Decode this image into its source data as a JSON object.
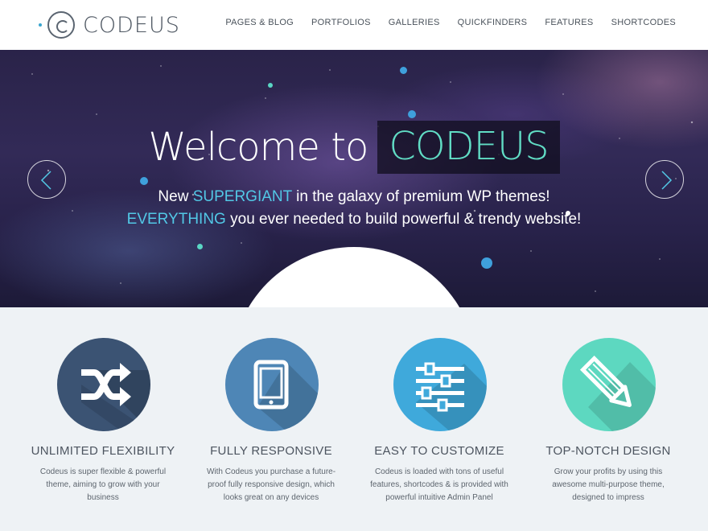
{
  "header": {
    "logo_text": "CODEUS",
    "nav": [
      "PAGES & BLOG",
      "PORTFOLIOS",
      "GALLERIES",
      "QUICKFINDERS",
      "FEATURES",
      "SHORTCODES"
    ]
  },
  "hero": {
    "welcome": "Welcome to",
    "brand": "CODEUS",
    "line1_pre": "New ",
    "line1_highlight": "SUPERGIANT",
    "line1_post": " in the galaxy of premium WP themes!",
    "line2_highlight": "EVERYTHING",
    "line2_post": " you ever needed to build powerful & trendy website!",
    "prev_icon": "chevron-left-icon",
    "next_icon": "chevron-right-icon"
  },
  "features": [
    {
      "title": "UNLIMITED FLEXIBILITY",
      "desc": "Codeus is super flexible & powerful theme, aiming to grow with your business",
      "icon": "shuffle-icon",
      "color": "#3b5373"
    },
    {
      "title": "FULLY RESPONSIVE",
      "desc": "With Codeus you purchase a future-proof fully responsive design, which looks great on any devices",
      "icon": "tablet-icon",
      "color": "#4e86b6"
    },
    {
      "title": "EASY TO CUSTOMIZE",
      "desc": "Codeus is loaded with tons of useful features, shortcodes & is provided with powerful intuitive Admin Panel",
      "icon": "sliders-icon",
      "color": "#3fa9db"
    },
    {
      "title": "TOP-NOTCH DESIGN",
      "desc": "Grow your profits by using this awesome multi-purpose theme, designed to impress",
      "icon": "pencil-icon",
      "color": "#5dd8c0"
    }
  ],
  "colors": {
    "accent_teal": "#61ddc5",
    "accent_blue": "#52c8e6",
    "feature_bg": "#eef2f5"
  }
}
